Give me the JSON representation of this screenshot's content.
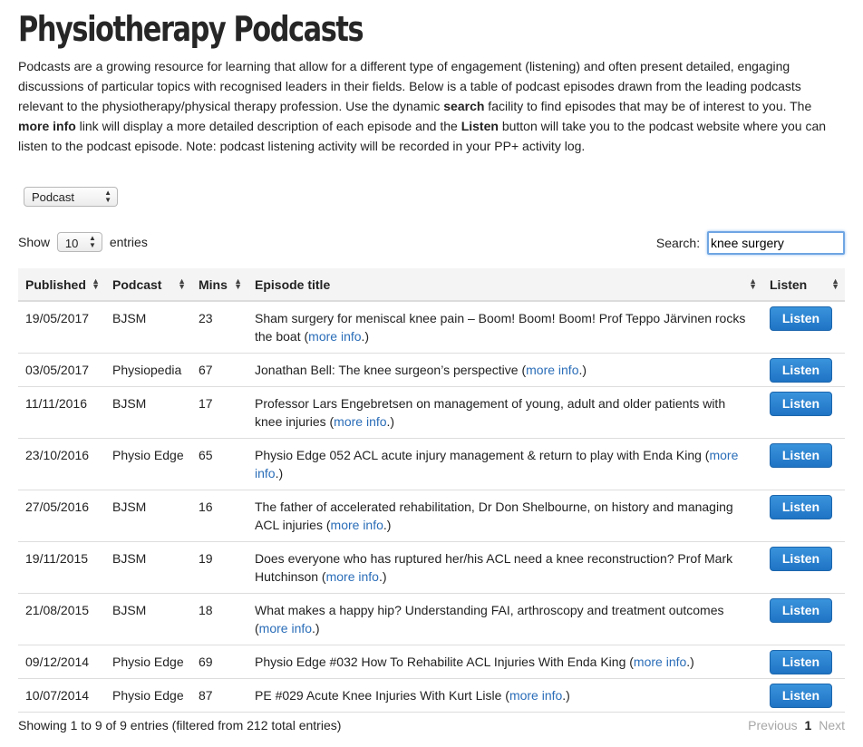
{
  "page": {
    "title": "Physiotherapy Podcasts",
    "intro": {
      "p1": "Podcasts are a growing resource for learning that allow for a different type of engagement (listening) and often present detailed, engaging discussions of particular topics with recognised leaders in their fields. Below is a table of podcast episodes drawn from the leading podcasts relevant to the physiotherapy/physical therapy profession. Use the dynamic ",
      "search_word": "search",
      "p2": " facility to find episodes that may be of interest to you. The ",
      "more_info_word": "more info",
      "p3": " link will display a more detailed description of each episode and the ",
      "listen_word": "Listen",
      "p4": " button will take you to the podcast website where you can listen to the podcast episode. Note: podcast listening activity will be recorded in your PP+ activity log."
    }
  },
  "filter": {
    "selected": "Podcast"
  },
  "length": {
    "show_label": "Show",
    "value": "10",
    "entries_label": "entries"
  },
  "search": {
    "label": "Search:",
    "value": "knee surgery"
  },
  "table": {
    "headers": {
      "published": "Published",
      "podcast": "Podcast",
      "mins": "Mins",
      "title": "Episode title",
      "listen": "Listen"
    },
    "more_info_label": "more info",
    "listen_label": "Listen",
    "rows": [
      {
        "published": "19/05/2017",
        "podcast": "BJSM",
        "mins": "23",
        "title": "Sham surgery for meniscal knee pain – Boom! Boom! Boom! Prof Teppo Järvinen rocks the boat"
      },
      {
        "published": "03/05/2017",
        "podcast": "Physiopedia",
        "mins": "67",
        "title": "Jonathan Bell: The knee surgeon’s perspective"
      },
      {
        "published": "11/11/2016",
        "podcast": "BJSM",
        "mins": "17",
        "title": "Professor Lars Engebretsen on management of young, adult and older patients with knee injuries"
      },
      {
        "published": "23/10/2016",
        "podcast": "Physio Edge",
        "mins": "65",
        "title": "Physio Edge 052 ACL acute injury management & return to play with Enda King"
      },
      {
        "published": "27/05/2016",
        "podcast": "BJSM",
        "mins": "16",
        "title": "The father of accelerated rehabilitation, Dr Don Shelbourne, on history and managing ACL injuries"
      },
      {
        "published": "19/11/2015",
        "podcast": "BJSM",
        "mins": "19",
        "title": "Does everyone who has ruptured her/his ACL need a knee reconstruction? Prof Mark Hutchinson"
      },
      {
        "published": "21/08/2015",
        "podcast": "BJSM",
        "mins": "18",
        "title": "What makes a happy hip? Understanding FAI, arthroscopy and treatment outcomes"
      },
      {
        "published": "09/12/2014",
        "podcast": "Physio Edge",
        "mins": "69",
        "title": "Physio Edge #032 How To Rehabilite ACL Injuries With Enda King"
      },
      {
        "published": "10/07/2014",
        "podcast": "Physio Edge",
        "mins": "87",
        "title": "PE #029 Acute Knee Injuries With Kurt Lisle"
      }
    ]
  },
  "footer": {
    "info": "Showing 1 to 9 of 9 entries (filtered from 212 total entries)",
    "previous": "Previous",
    "current_page": "1",
    "next": "Next"
  }
}
